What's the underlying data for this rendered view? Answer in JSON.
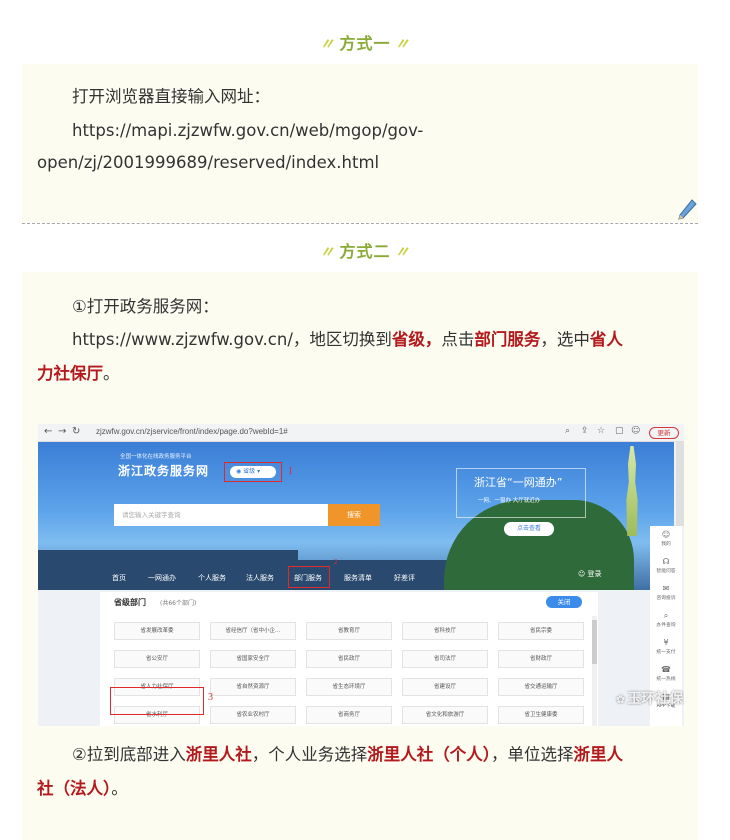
{
  "method1": {
    "heading": "方式一",
    "intro": "打开浏览器直接输入网址：",
    "url_line1": "https://mapi.zjzwfw.gov.cn/web/mgop/gov-",
    "url_line2": "open/zj/2001999689/reserved/index.html"
  },
  "method2": {
    "heading": "方式二",
    "step1_label": "①打开政务服务网：",
    "step1_url": "https://www.zjzwfw.gov.cn/",
    "step1_t1": "，地区切换到",
    "step1_h1": "省级，",
    "step1_t2": "点击",
    "step1_h2": "部门服务",
    "step1_t3": "，选中",
    "step1_h3a": "省人",
    "step1_h3b": "力社保厅",
    "step1_end": "。",
    "step2_t1": "②拉到底部进入",
    "step2_h1": "浙里人社",
    "step2_t2": "，个人业务选择",
    "step2_h2": "浙里人社（个人）",
    "step2_t3": "，单位选择",
    "step2_h3a": "浙里人",
    "step2_h3b": "社（法人）",
    "step2_end": "。"
  },
  "screenshot": {
    "browser_url": "zjzwfw.gov.cn/zjservice/front/index/page.do?webId=1#",
    "update_label": "更新",
    "banner_sub": "全国一体化在线政务服务平台",
    "banner_title": "浙江政务服务网",
    "province_selector": "省级",
    "search_placeholder": "请您输入关键字查询",
    "search_button": "搜索",
    "slogan": "浙江省“一网通办”",
    "slogan_sub": "一网、一窗办 大厅就近办",
    "view_button": "点击查看",
    "nav_items": [
      "首页",
      "一网通办",
      "个人服务",
      "法人服务",
      "部门服务",
      "服务清单",
      "好差评"
    ],
    "login_label": "登录",
    "panel_title": "省级部门",
    "panel_count": "(共66个部门)",
    "close_button": "关闭",
    "departments": [
      "省发展改革委",
      "省经信厅（省中小企…",
      "省教育厅",
      "省科技厅",
      "省民宗委",
      "省公安厅",
      "省国家安全厅",
      "省民政厅",
      "省司法厅",
      "省财政厅",
      "省人力社保厅",
      "省自然资源厅",
      "省生态环境厅",
      "省建设厅",
      "省交通运输厅",
      "省水利厅",
      "省农业农村厅",
      "省商务厅",
      "省文化和旅游厅",
      "省卫生健康委"
    ],
    "annotations": [
      "1",
      "2",
      "3"
    ],
    "rail": [
      "我的",
      "智能问答",
      "咨询投诉",
      "办件查询",
      "统一支付",
      "统一热线",
      "APP下载"
    ],
    "watermark": "玉环社保"
  },
  "colors": {
    "heading": "#8aaa35",
    "highlight": "#b3191d",
    "card_bg": "#fdfcf1",
    "annotation": "#e02a2a"
  }
}
